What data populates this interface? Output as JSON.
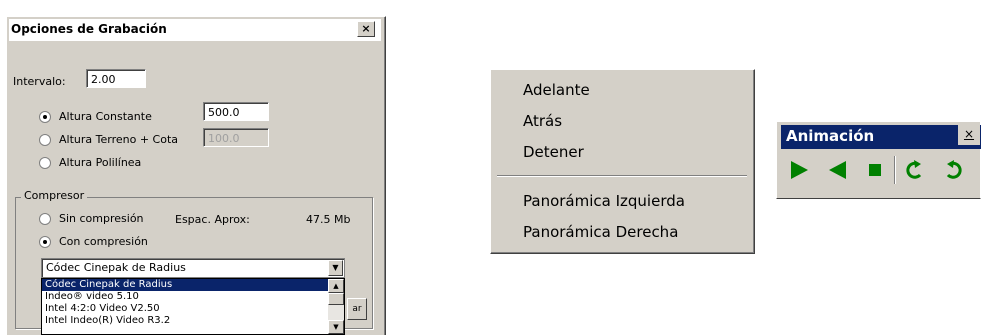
{
  "dialog": {
    "title": "Opciones de Grabación",
    "close_glyph": "×",
    "interval_label": "Intervalo:",
    "interval_value": "2.00",
    "altura_constante_label": "Altura Constante",
    "altura_constante_value": "500.0",
    "altura_terreno_label": "Altura Terreno + Cota",
    "altura_terreno_value": "100.0",
    "altura_polilinea_label": "Altura Polilínea",
    "compresor_title": "Compresor",
    "sin_compresion_label": "Sin compresión",
    "espac_label": "Espac. Aprox:",
    "espac_value": "47.5 Mb",
    "con_compresion_label": "Con compresión",
    "codec_selected": "Códec Cinepak de Radius",
    "codec_options": [
      "Códec Cinepak de Radius",
      "Indeo® video 5.10",
      "Intel 4:2:0 Video V2.50",
      "Intel Indeo(R) Video R3.2"
    ],
    "side_button_label": "ar"
  },
  "context_menu": {
    "items": [
      "Adelante",
      "Atrás",
      "Detener"
    ],
    "items2": [
      "Panorámica Izquierda",
      "Panorámica Derecha"
    ]
  },
  "toolbar": {
    "title": "Animación",
    "close_glyph": "×",
    "accent": "#008000",
    "icons": [
      "play-icon",
      "reverse-icon",
      "stop-icon",
      "rotate-right-icon",
      "rotate-left-icon"
    ]
  }
}
